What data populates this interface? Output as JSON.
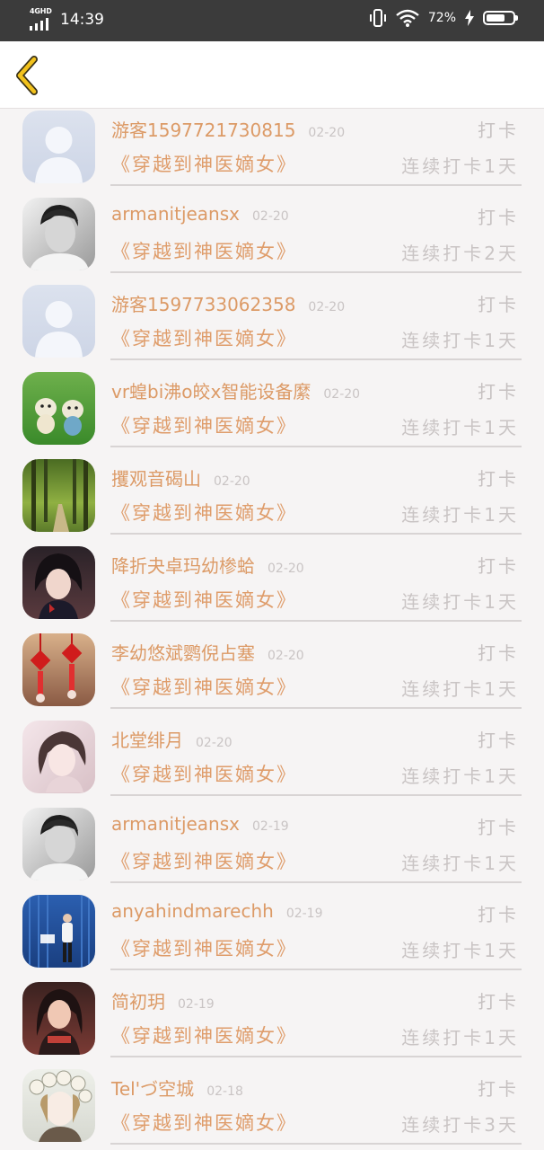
{
  "status_bar": {
    "network": "4GHD",
    "time": "14:39",
    "battery_percent": "72%",
    "battery_level": 0.72
  },
  "app_bar": {
    "back_icon": "chevron-left-icon",
    "accent": "#f2c21c"
  },
  "colors": {
    "name": "#dc9a66",
    "muted": "#c6c1c1",
    "background": "#f6f4f4"
  },
  "rows": [
    {
      "user": "游客1597721730815",
      "date": "02-20",
      "action": "打卡",
      "book": "《穿越到神医嫡女》",
      "streak": "连续打卡1天",
      "avatar": "default-avatar-icon"
    },
    {
      "user": "armanitjeansx",
      "date": "02-20",
      "action": "打卡",
      "book": "《穿越到神医嫡女》",
      "streak": "连续打卡2天",
      "avatar": "boy-portrait-avatar"
    },
    {
      "user": "游客1597733062358",
      "date": "02-20",
      "action": "打卡",
      "book": "《穿越到神医嫡女》",
      "streak": "连续打卡1天",
      "avatar": "default-avatar-icon"
    },
    {
      "user": "vr蝗bi沸o皎x智能设备縻",
      "date": "02-20",
      "action": "打卡",
      "book": "《穿越到神医嫡女》",
      "streak": "连续打卡1天",
      "avatar": "toy-animals-avatar"
    },
    {
      "user": "攫观音碣山",
      "date": "02-20",
      "action": "打卡",
      "book": "《穿越到神医嫡女》",
      "streak": "连续打卡1天",
      "avatar": "forest-path-avatar"
    },
    {
      "user": "降折夬卓玛幼椮蛤",
      "date": "02-20",
      "action": "打卡",
      "book": "《穿越到神医嫡女》",
      "streak": "连续打卡1天",
      "avatar": "anime-character-avatar"
    },
    {
      "user": "李幼悠斌鹦倪占塞",
      "date": "02-20",
      "action": "打卡",
      "book": "《穿越到神医嫡女》",
      "streak": "连续打卡1天",
      "avatar": "chinese-knots-avatar"
    },
    {
      "user": "北堂绯月",
      "date": "02-20",
      "action": "打卡",
      "book": "《穿越到神医嫡女》",
      "streak": "连续打卡1天",
      "avatar": "illustrated-girl-avatar"
    },
    {
      "user": "armanitjeansx",
      "date": "02-19",
      "action": "打卡",
      "book": "《穿越到神医嫡女》",
      "streak": "连续打卡1天",
      "avatar": "boy-portrait-avatar"
    },
    {
      "user": "anyahindmarechh",
      "date": "02-19",
      "action": "打卡",
      "book": "《穿越到神医嫡女》",
      "streak": "连续打卡1天",
      "avatar": "blue-container-avatar"
    },
    {
      "user": "简初玥",
      "date": "02-19",
      "action": "打卡",
      "book": "《穿越到神医嫡女》",
      "streak": "连续打卡1天",
      "avatar": "woman-portrait-avatar"
    },
    {
      "user": "Tel'づ空城",
      "date": "02-18",
      "action": "打卡",
      "book": "《穿越到神医嫡女》",
      "streak": "连续打卡3天",
      "avatar": "flower-crown-girl-avatar"
    }
  ]
}
